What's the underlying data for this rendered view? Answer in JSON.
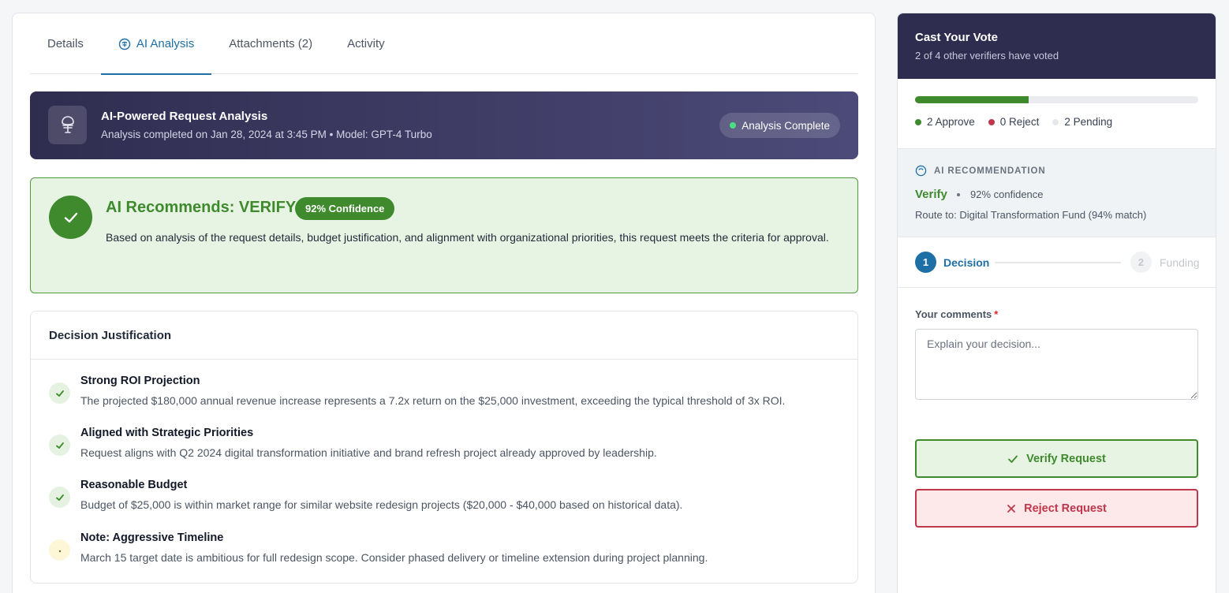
{
  "tabs": [
    {
      "label": "Details",
      "active": false
    },
    {
      "label": "AI Analysis",
      "active": true
    },
    {
      "label": "Attachments (2)",
      "active": false
    },
    {
      "label": "Activity",
      "active": false
    }
  ],
  "banner": {
    "title": "AI-Powered Request Analysis",
    "subtitle": "Analysis completed on Jan 28, 2024 at 3:45 PM • Model: GPT-4 Turbo",
    "status": "Analysis Complete",
    "icon": "ai-brain-icon"
  },
  "recommendation": {
    "title": "AI Recommends: VERIFY",
    "confidence": "92% Confidence",
    "text": "Based on analysis of the request details, budget justification, and alignment with organizational priorities, this request meets the criteria for approval."
  },
  "justification": {
    "header": "Decision Justification",
    "items": [
      {
        "kind": "ok",
        "title": "Strong ROI Projection",
        "desc": "The projected $180,000 annual revenue increase represents a 7.2x return on the $25,000 investment, exceeding the typical threshold of 3x ROI."
      },
      {
        "kind": "ok",
        "title": "Aligned with Strategic Priorities",
        "desc": "Request aligns with Q2 2024 digital transformation initiative and brand refresh project already approved by leadership."
      },
      {
        "kind": "ok",
        "title": "Reasonable Budget",
        "desc": "Budget of $25,000 is within market range for similar website redesign projects ($20,000 - $40,000 based on historical data)."
      },
      {
        "kind": "warn",
        "title": "Note: Aggressive Timeline",
        "desc": "March 15 target date is ambitious for full redesign scope. Consider phased delivery or timeline extension during project planning."
      }
    ]
  },
  "vote": {
    "title": "Cast Your Vote",
    "subtitle": "2 of 4 other verifiers have voted",
    "progress_fraction": 0.4,
    "legend": [
      {
        "label": "2 Approve",
        "color": "#3e8a2c"
      },
      {
        "label": "0 Reject",
        "color": "#c0364a"
      },
      {
        "label": "2 Pending",
        "color": "#e5e7eb"
      }
    ]
  },
  "ai_rec": {
    "label": "AI RECOMMENDATION",
    "verdict": "Verify",
    "confidence": "92% confidence",
    "route": "Route to: Digital Transformation Fund (94% match)"
  },
  "steps": [
    {
      "number": "1",
      "label": "Decision",
      "active": true
    },
    {
      "number": "2",
      "label": "Funding",
      "active": false
    }
  ],
  "comments": {
    "label": "Your comments",
    "required_mark": "*",
    "placeholder": "Explain your decision...",
    "value": ""
  },
  "actions": {
    "verify_label": "Verify Request",
    "reject_label": "Reject Request"
  },
  "colors": {
    "accent": "#1d6fa5",
    "success": "#3e8a2c",
    "danger": "#c0364a",
    "banner_dark": "#2f2d4f"
  }
}
